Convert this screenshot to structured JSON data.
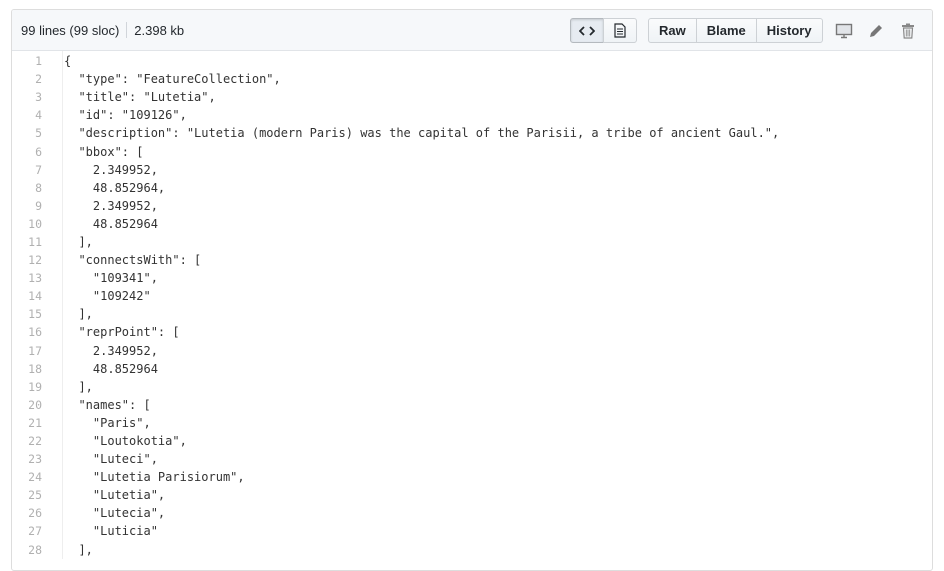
{
  "file_header": {
    "lines_info": "99 lines (99 sloc)",
    "size": "2.398 kb"
  },
  "toolbar": {
    "code_view_icon": "code-icon",
    "file_view_icon": "file-text-icon",
    "raw_label": "Raw",
    "blame_label": "Blame",
    "history_label": "History",
    "desktop_icon": "desktop-icon",
    "edit_icon": "pencil-icon",
    "delete_icon": "trash-icon"
  },
  "code": {
    "lines": [
      {
        "num": "1",
        "text": "{"
      },
      {
        "num": "2",
        "text": "  \"type\": \"FeatureCollection\","
      },
      {
        "num": "3",
        "text": "  \"title\": \"Lutetia\","
      },
      {
        "num": "4",
        "text": "  \"id\": \"109126\","
      },
      {
        "num": "5",
        "text": "  \"description\": \"Lutetia (modern Paris) was the capital of the Parisii, a tribe of ancient Gaul.\","
      },
      {
        "num": "6",
        "text": "  \"bbox\": ["
      },
      {
        "num": "7",
        "text": "    2.349952,"
      },
      {
        "num": "8",
        "text": "    48.852964,"
      },
      {
        "num": "9",
        "text": "    2.349952,"
      },
      {
        "num": "10",
        "text": "    48.852964"
      },
      {
        "num": "11",
        "text": "  ],"
      },
      {
        "num": "12",
        "text": "  \"connectsWith\": ["
      },
      {
        "num": "13",
        "text": "    \"109341\","
      },
      {
        "num": "14",
        "text": "    \"109242\""
      },
      {
        "num": "15",
        "text": "  ],"
      },
      {
        "num": "16",
        "text": "  \"reprPoint\": ["
      },
      {
        "num": "17",
        "text": "    2.349952,"
      },
      {
        "num": "18",
        "text": "    48.852964"
      },
      {
        "num": "19",
        "text": "  ],"
      },
      {
        "num": "20",
        "text": "  \"names\": ["
      },
      {
        "num": "21",
        "text": "    \"Paris\","
      },
      {
        "num": "22",
        "text": "    \"Loutokotia\","
      },
      {
        "num": "23",
        "text": "    \"Luteci\","
      },
      {
        "num": "24",
        "text": "    \"Lutetia Parisiorum\","
      },
      {
        "num": "25",
        "text": "    \"Lutetia\","
      },
      {
        "num": "26",
        "text": "    \"Lutecia\","
      },
      {
        "num": "27",
        "text": "    \"Luticia\""
      },
      {
        "num": "28",
        "text": "  ],"
      }
    ]
  }
}
